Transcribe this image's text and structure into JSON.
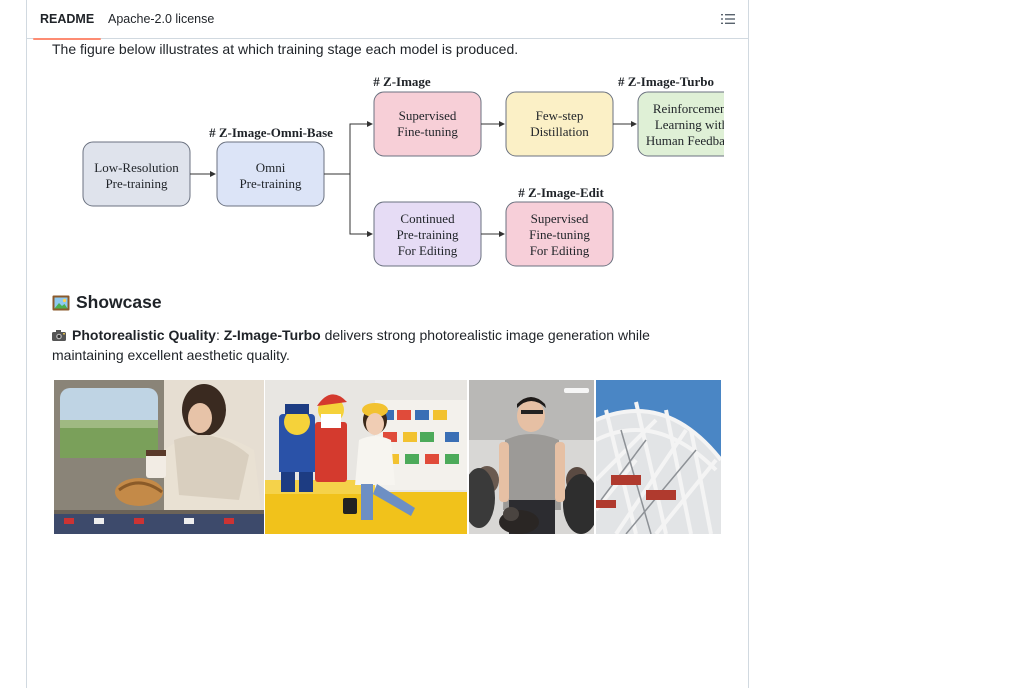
{
  "tabs": {
    "readme": "README",
    "license": "Apache-2.0 license"
  },
  "intro": "The figure below illustrates at which training stage each model is produced.",
  "diagram": {
    "labels": {
      "z_image": "# Z-Image",
      "z_image_turbo": "# Z-Image-Turbo",
      "z_image_omni_base": "# Z-Image-Omni-Base",
      "z_image_edit": "# Z-Image-Edit"
    },
    "boxes": {
      "low_res": [
        "Low-Resolution",
        "Pre-training"
      ],
      "omni": [
        "Omni",
        "Pre-training"
      ],
      "sft": [
        "Supervised",
        "Fine-tuning"
      ],
      "distill": [
        "Few-step",
        "Distillation"
      ],
      "rlhf": [
        "Reinforcement",
        "Learning with",
        "Human Feedback"
      ],
      "cont_pt": [
        "Continued",
        "Pre-training",
        "For Editing"
      ],
      "sft_edit": [
        "Supervised",
        "Fine-tuning",
        "For Editing"
      ]
    },
    "colors": {
      "low_res": "#dfe3ec",
      "omni": "#dce4f7",
      "sft": "#f7cfd7",
      "distill": "#fbf0c6",
      "rlhf": "#dff0d6",
      "cont_pt": "#e6dcf5",
      "sft_edit": "#f7cfd9"
    }
  },
  "showcase": {
    "title": "Showcase",
    "bold_label": "Photorealistic Quality",
    "colon": ":",
    "model": "Z-Image-Turbo",
    "text": " delivers strong photorealistic image generation while maintaining excellent aesthetic quality."
  },
  "icons": {
    "toc": "list-icon",
    "showcase": "framed-picture-icon",
    "quality": "camera-flash-icon"
  }
}
